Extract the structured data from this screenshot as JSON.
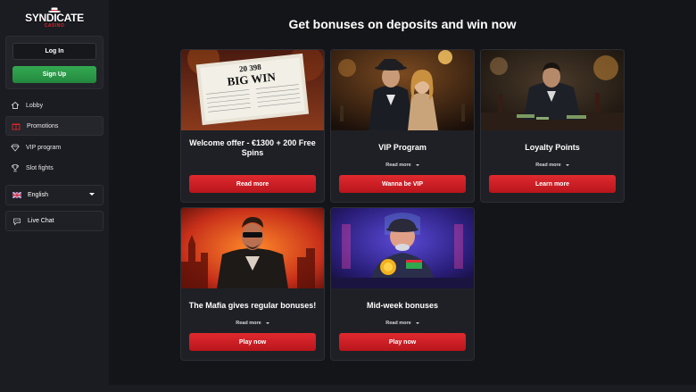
{
  "brand": {
    "name": "SYNDICATE",
    "sub": "CASINO"
  },
  "auth": {
    "login_label": "Log In",
    "signup_label": "Sign Up"
  },
  "nav": {
    "items": [
      {
        "label": "Lobby",
        "icon": "home-icon"
      },
      {
        "label": "Promotions",
        "icon": "gift-icon",
        "active": true
      },
      {
        "label": "VIP program",
        "icon": "diamond-icon"
      },
      {
        "label": "Slot fights",
        "icon": "trophy-icon"
      }
    ]
  },
  "language": {
    "label": "English",
    "icon": "uk-flag-icon"
  },
  "chat": {
    "label": "Live Chat",
    "icon": "chat-icon"
  },
  "main": {
    "title": "Get bonuses on deposits and win now",
    "cards": [
      {
        "title": "Welcome offer - €1300 + 200 Free Spins",
        "more": "",
        "cta": "Read more",
        "image": "newspaper-big-win",
        "headline_top": "20 398",
        "headline_bottom": "BIG WIN"
      },
      {
        "title": "VIP Program",
        "more": "Read more",
        "cta": "Wanna be VIP",
        "image": "gangster-couple"
      },
      {
        "title": "Loyalty Points",
        "more": "Read more",
        "cta": "Learn more",
        "image": "gangster-counting-money"
      },
      {
        "title": "The Mafia gives regular bonuses!",
        "more": "Read more",
        "cta": "Play now",
        "image": "mafia-boss-fire"
      },
      {
        "title": "Mid-week bonuses",
        "more": "Read more",
        "cta": "Play now",
        "image": "chubby-mobster-money"
      }
    ]
  },
  "colors": {
    "accent_red": "#d9252b",
    "signup_green": "#2ea04c",
    "bg": "#141519",
    "sidebar": "#1b1c21"
  }
}
